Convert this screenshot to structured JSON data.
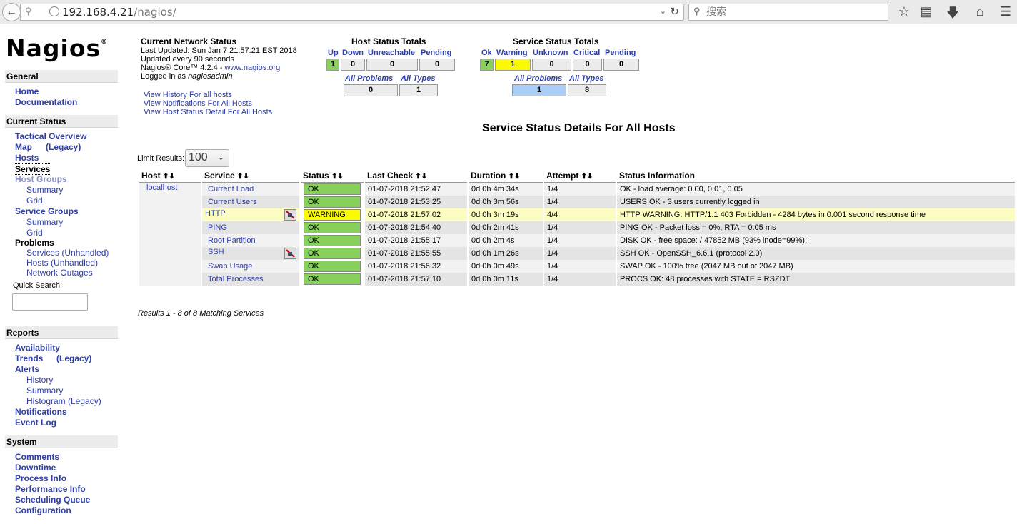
{
  "browser": {
    "url_host": "192.168.4.21",
    "url_path": "/nagios/",
    "search_placeholder": "搜索"
  },
  "logo": "Nagios",
  "sidebar": {
    "general": {
      "title": "General",
      "home": "Home",
      "documentation": "Documentation"
    },
    "current_status": {
      "title": "Current Status",
      "tactical_overview": "Tactical Overview",
      "map": "Map",
      "map_legacy": "(Legacy)",
      "hosts": "Hosts",
      "services": "Services",
      "host_groups": "Host Groups",
      "hg_summary": "Summary",
      "hg_grid": "Grid",
      "service_groups": "Service Groups",
      "sg_summary": "Summary",
      "sg_grid": "Grid",
      "problems": "Problems",
      "p_services": "Services",
      "p_services_unhandled": "Unhandled",
      "p_hosts": "Hosts",
      "p_hosts_unhandled": "Unhandled",
      "p_network_outages": "Network Outages",
      "quick_search": "Quick Search:"
    },
    "reports": {
      "title": "Reports",
      "availability": "Availability",
      "trends": "Trends",
      "trends_legacy": "(Legacy)",
      "alerts": "Alerts",
      "history": "History",
      "summary": "Summary",
      "histogram": "Histogram (Legacy)",
      "notifications": "Notifications",
      "event_log": "Event Log"
    },
    "system": {
      "title": "System",
      "comments": "Comments",
      "downtime": "Downtime",
      "process_info": "Process Info",
      "performance_info": "Performance Info",
      "scheduling_queue": "Scheduling Queue",
      "configuration": "Configuration"
    }
  },
  "info": {
    "title": "Current Network Status",
    "last_updated": "Last Updated: Sun Jan 7 21:57:21 EST 2018",
    "updated_every": "Updated every 90 seconds",
    "version": "Nagios® Core™ 4.2.4 - ",
    "version_link": "www.nagios.org",
    "logged_in": "Logged in as ",
    "user": "nagiosadmin",
    "link_history": "View History For all hosts",
    "link_notifications": "View Notifications For All Hosts",
    "link_host_detail": "View Host Status Detail For All Hosts"
  },
  "host_totals": {
    "title": "Host Status Totals",
    "labels": {
      "up": "Up",
      "down": "Down",
      "unreachable": "Unreachable",
      "pending": "Pending"
    },
    "values": {
      "up": "1",
      "down": "0",
      "unreachable": "0",
      "pending": "0"
    },
    "all_problems_label": "All Problems",
    "all_types_label": "All Types",
    "all_problems": "0",
    "all_types": "1"
  },
  "service_totals": {
    "title": "Service Status Totals",
    "labels": {
      "ok": "Ok",
      "warning": "Warning",
      "unknown": "Unknown",
      "critical": "Critical",
      "pending": "Pending"
    },
    "values": {
      "ok": "7",
      "warning": "1",
      "unknown": "0",
      "critical": "0",
      "pending": "0"
    },
    "all_problems_label": "All Problems",
    "all_types_label": "All Types",
    "all_problems": "1",
    "all_types": "8"
  },
  "main": {
    "heading": "Service Status Details For All Hosts",
    "limit_label": "Limit Results:",
    "limit_value": "100",
    "columns": {
      "host": "Host",
      "service": "Service",
      "status": "Status",
      "last_check": "Last Check",
      "duration": "Duration",
      "attempt": "Attempt",
      "status_info": "Status Information"
    },
    "host": "localhost",
    "rows": [
      {
        "service": "Current Load",
        "status": "OK",
        "last_check": "01-07-2018 21:52:47",
        "duration": "0d 0h 4m 34s",
        "attempt": "1/4",
        "info": "OK - load average: 0.00, 0.01, 0.05"
      },
      {
        "service": "Current Users",
        "status": "OK",
        "last_check": "01-07-2018 21:53:25",
        "duration": "0d 0h 3m 56s",
        "attempt": "1/4",
        "info": "USERS OK - 3 users currently logged in"
      },
      {
        "service": "HTTP",
        "status": "WARNING",
        "last_check": "01-07-2018 21:57:02",
        "duration": "0d 0h 3m 19s",
        "attempt": "4/4",
        "info": "HTTP WARNING: HTTP/1.1 403 Forbidden - 4284 bytes in 0.001 second response time"
      },
      {
        "service": "PING",
        "status": "OK",
        "last_check": "01-07-2018 21:54:40",
        "duration": "0d 0h 2m 41s",
        "attempt": "1/4",
        "info": "PING OK - Packet loss = 0%, RTA = 0.05 ms"
      },
      {
        "service": "Root Partition",
        "status": "OK",
        "last_check": "01-07-2018 21:55:17",
        "duration": "0d 0h 2m 4s",
        "attempt": "1/4",
        "info": "DISK OK - free space: / 47852 MB (93% inode=99%):"
      },
      {
        "service": "SSH",
        "status": "OK",
        "last_check": "01-07-2018 21:55:55",
        "duration": "0d 0h 1m 26s",
        "attempt": "1/4",
        "info": "SSH OK - OpenSSH_6.6.1 (protocol 2.0)"
      },
      {
        "service": "Swap Usage",
        "status": "OK",
        "last_check": "01-07-2018 21:56:32",
        "duration": "0d 0h 0m 49s",
        "attempt": "1/4",
        "info": "SWAP OK - 100% free (2047 MB out of 2047 MB)"
      },
      {
        "service": "Total Processes",
        "status": "OK",
        "last_check": "01-07-2018 21:57:10",
        "duration": "0d 0h 0m 11s",
        "attempt": "1/4",
        "info": "PROCS OK: 48 processes with STATE = RSZDT"
      }
    ],
    "results": "Results 1 - 8 of 8 Matching Services"
  }
}
